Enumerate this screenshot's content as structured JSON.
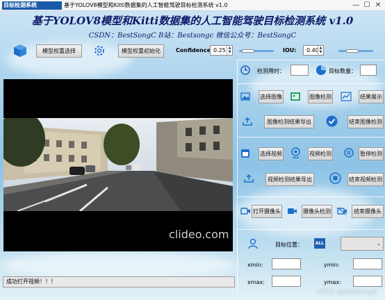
{
  "window": {
    "app_badge": "目标检测系统",
    "title": "基于YOLOV8模型和Kitti数据集的人工智能驾驶目标检测系统 v1.0",
    "minimize": "—",
    "maximize": "☐",
    "close": "✕"
  },
  "header": {
    "title": "基于YOLOV8模型和Kitti数据集的人工智能驾驶目标检测系统 v1.0",
    "subtitle": "CSDN：BestSongC   B站：Bestsongc   微信公众号：BestSongC"
  },
  "toolbar": {
    "model_select_label": "模型权重选择",
    "model_init_label": "模型权重初始化",
    "confidence_label": "Confidence:",
    "confidence_value": "0.25",
    "confidence_level": 0.25,
    "iou_label": "IOU:",
    "iou_value": "0.40",
    "iou_level": 0.4
  },
  "stats": {
    "time_label": "检测用时：",
    "time_value": "",
    "count_label": "目标数量：",
    "count_value": ""
  },
  "image_section": {
    "select_label": "选择图像",
    "detect_label": "图像检测",
    "show_label": "结果展示",
    "export_label": "图像检测结果导出",
    "end_label": "结束图像检测"
  },
  "video_section": {
    "select_label": "选择视频",
    "detect_label": "视频检测",
    "pause_label": "暂停检测",
    "export_label": "视频检测结果导出",
    "end_label": "结束视频检测"
  },
  "camera_section": {
    "open_label": "打开摄像头",
    "detect_label": "摄像头检测",
    "end_label": "结束摄像头"
  },
  "target": {
    "position_label": "目标位置：",
    "all_badge": "ALL",
    "select_value": "",
    "xmin_label": "xmin:",
    "ymin_label": "ymin:",
    "xmax_label": "xmax:",
    "ymax_label": "ymax:"
  },
  "video": {
    "watermark": "clideo.com"
  },
  "status": {
    "message": "成功打开视频！！！"
  },
  "footer": {
    "watermark": "CSDN @BestSongC"
  }
}
